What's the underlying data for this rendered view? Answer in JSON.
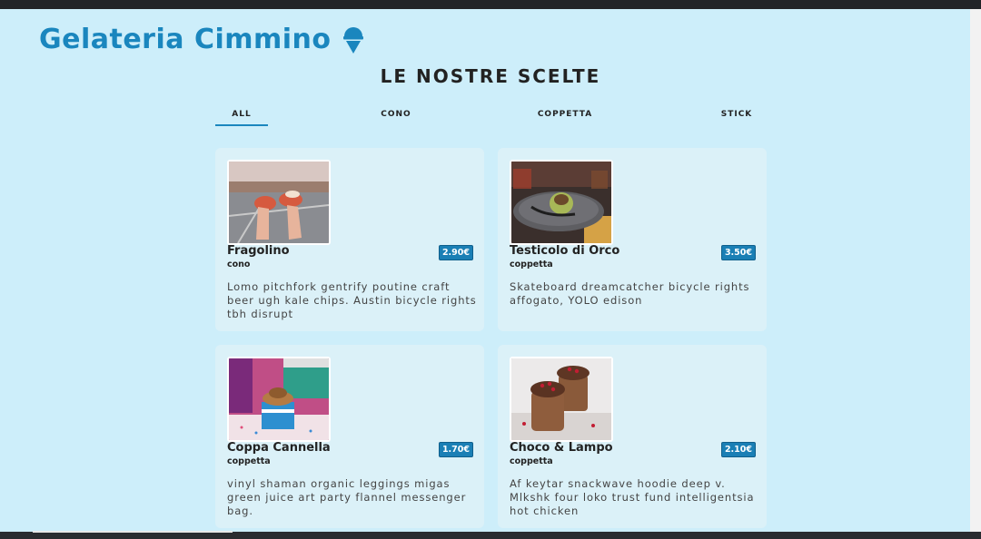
{
  "header": {
    "brand": "Gelateria Cimmino",
    "brand_icon": "ice-cream-icon",
    "accent_color": "#1a86be"
  },
  "section": {
    "title": "LE NOSTRE SCELTE"
  },
  "tabs": [
    {
      "label": "ALL",
      "active": true
    },
    {
      "label": "CONO",
      "active": false
    },
    {
      "label": "COPPETTA",
      "active": false
    },
    {
      "label": "STICK",
      "active": false
    }
  ],
  "items": [
    {
      "name": "Fragolino",
      "category": "cono",
      "price": "2.90€",
      "description": "Lomo pitchfork gentrify poutine craft beer ugh kale chips. Austin bicycle rights tbh disrupt"
    },
    {
      "name": "Testicolo di Orco",
      "category": "coppetta",
      "price": "3.50€",
      "description": "Skateboard dreamcatcher bicycle rights affogato, YOLO edison"
    },
    {
      "name": "Coppa Cannella",
      "category": "coppetta",
      "price": "1.70€",
      "description": "vinyl shaman organic leggings migas green juice art party flannel messenger bag."
    },
    {
      "name": "Choco & Lampo",
      "category": "coppetta",
      "price": "2.10€",
      "description": "Af keytar snackwave hoodie deep v. Mlkshk four loko trust fund intelligentsia hot chicken"
    }
  ]
}
